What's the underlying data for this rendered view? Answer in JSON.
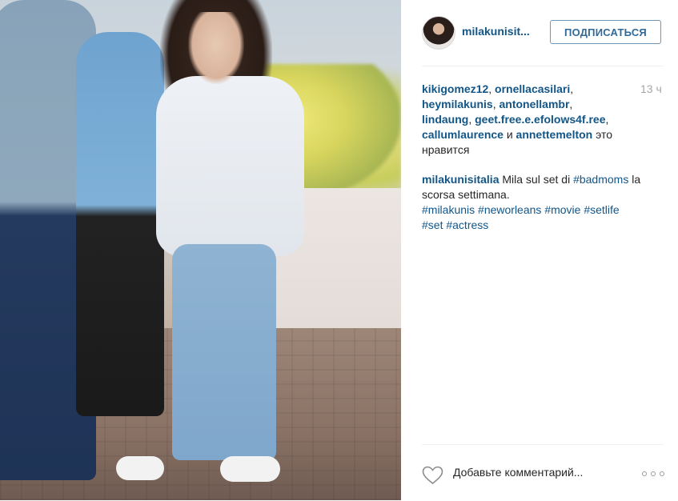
{
  "post": {
    "header": {
      "username": "milakunisit...",
      "follow_label": "ПОДПИСАТЬСЯ"
    },
    "likes": {
      "users": [
        "kikigomez12",
        "ornellacasilari",
        "heymilakunis",
        "antonellambr",
        "lindaung",
        "geet.free.e.efolows4f.ree",
        "callumlaurence",
        "annettemelton"
      ],
      "separator": ", ",
      "conjunction": " и ",
      "suffix": " это нравится"
    },
    "timestamp": "13 ч",
    "caption": {
      "username": "milakunisitalia",
      "text_1": " Mila sul set di ",
      "hashtag_1": "#badmoms",
      "text_2": " la scorsa settimana.",
      "hashtags": [
        "#milakunis",
        "#neworleans",
        "#movie",
        "#setlife",
        "#set",
        "#actress"
      ]
    },
    "footer": {
      "comment_placeholder": "Добавьте комментарий..."
    },
    "icons": {
      "like": "heart-outline-icon",
      "more": "ellipsis-icon"
    },
    "colors": {
      "link": "#125688",
      "follow_border": "#6f97b6",
      "timestamp": "#a5a7aa"
    }
  }
}
